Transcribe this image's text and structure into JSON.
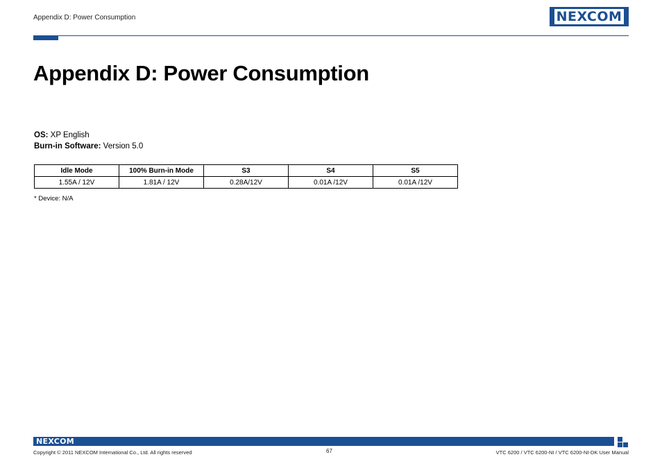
{
  "header": {
    "section": "Appendix D: Power Consumption",
    "logo_text": "NEXCOM"
  },
  "title": "Appendix D: Power Consumption",
  "info": {
    "os_label": "OS:",
    "os_value": " XP English",
    "software_label": "Burn-in Software:",
    "software_value": " Version 5.0"
  },
  "table": {
    "headers": [
      "Idle Mode",
      "100% Burn-in Mode",
      "S3",
      "S4",
      "S5"
    ],
    "rows": [
      [
        "1.55A / 12V",
        "1.81A / 12V",
        "0.28A/12V",
        "0.01A /12V",
        "0.01A /12V"
      ]
    ]
  },
  "note": "* Device: N/A",
  "footer": {
    "logo_text": "NEXCOM",
    "copyright": "Copyright © 2011 NEXCOM International Co., Ltd. All rights reserved",
    "page_number": "67",
    "manual": "VTC 6200 / VTC 6200-NI / VTC 6200-NI-DK User Manual"
  },
  "colors": {
    "brand_blue": "#1b4f93",
    "brand_green": "#2aa24a"
  }
}
